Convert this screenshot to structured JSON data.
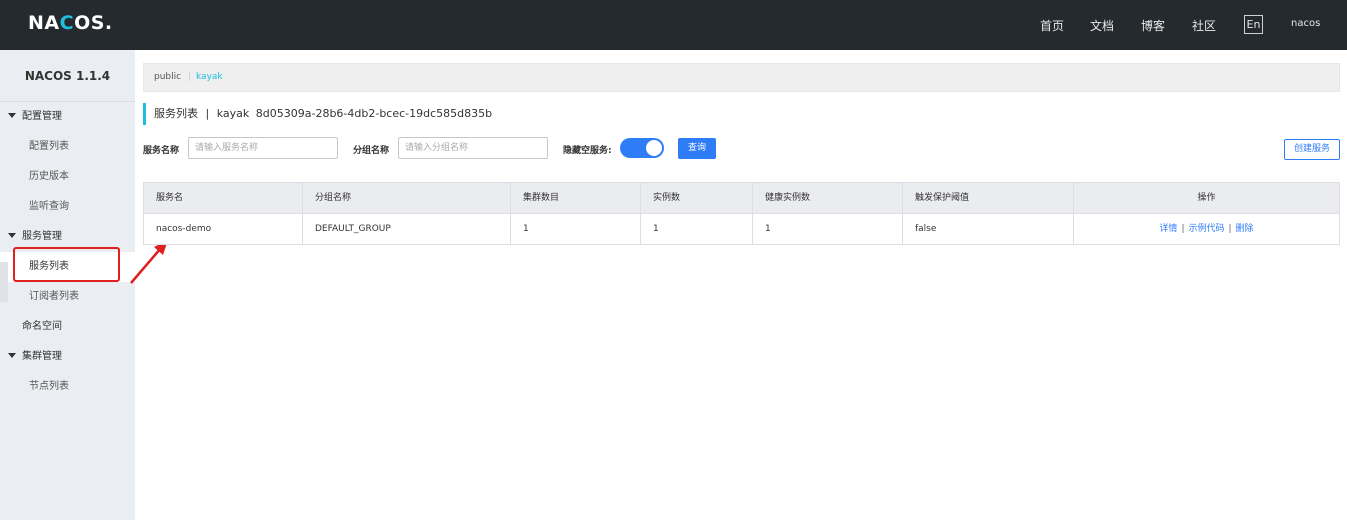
{
  "header": {
    "logo_pre": "NA",
    "logo_o": "C",
    "logo_mid": "O",
    "logo_post": "S.",
    "nav": [
      "首页",
      "文档",
      "博客",
      "社区"
    ],
    "lang": "En",
    "user": "nacos"
  },
  "sidebar": {
    "version": "NACOS 1.1.4",
    "groups": [
      {
        "label": "配置管理",
        "items": [
          "配置列表",
          "历史版本",
          "监听查询"
        ]
      },
      {
        "label": "服务管理",
        "items": [
          "服务列表",
          "订阅者列表"
        ]
      },
      {
        "label": "命名空间",
        "items": []
      },
      {
        "label": "集群管理",
        "items": [
          "节点列表"
        ]
      }
    ]
  },
  "namespaces": [
    "public",
    "kayak"
  ],
  "title": {
    "text": "服务列表",
    "sep": "|",
    "namespace": "kayak",
    "namespace_id": "8d05309a-28b6-4db2-bcec-19dc585d835b"
  },
  "filters": {
    "service_label": "服务名称",
    "service_placeholder": "请输入服务名称",
    "group_label": "分组名称",
    "group_placeholder": "请输入分组名称",
    "hide_empty_label": "隐藏空服务:",
    "query_label": "查询",
    "create_label": "创建服务"
  },
  "table": {
    "headers": [
      "服务名",
      "分组名称",
      "集群数目",
      "实例数",
      "健康实例数",
      "触发保护阈值",
      "操作"
    ],
    "rows": [
      {
        "service": "nacos-demo",
        "group": "DEFAULT_GROUP",
        "clusters": "1",
        "instances": "1",
        "healthy": "1",
        "protect": "false",
        "ops": [
          "详情",
          "示例代码",
          "删除"
        ]
      }
    ]
  },
  "colors": {
    "header_bg": "#252a2f",
    "accent": "#2f7df6",
    "cyan": "#1fbfe0",
    "highlight": "#e02020"
  }
}
